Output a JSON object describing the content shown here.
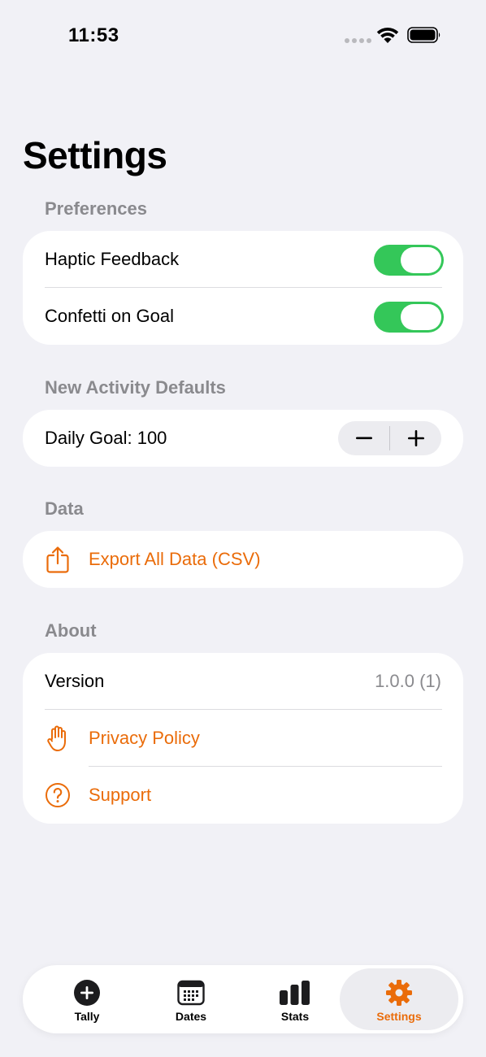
{
  "status_bar": {
    "time": "11:53"
  },
  "page_title": "Settings",
  "sections": {
    "preferences": {
      "header": "Preferences",
      "haptic_feedback": {
        "label": "Haptic Feedback",
        "on": true
      },
      "confetti_on_goal": {
        "label": "Confetti on Goal",
        "on": true
      }
    },
    "defaults": {
      "header": "New Activity Defaults",
      "daily_goal_label": "Daily Goal: 100",
      "decrement": "−",
      "increment": "+"
    },
    "data": {
      "header": "Data",
      "export_label": "Export All Data (CSV)",
      "export_icon": "share-icon"
    },
    "about": {
      "header": "About",
      "version_label": "Version",
      "version_value": "1.0.0 (1)",
      "privacy_label": "Privacy Policy",
      "privacy_icon": "hand-raised-icon",
      "support_label": "Support",
      "support_icon": "question-circle-icon"
    }
  },
  "tab_bar": {
    "tabs": [
      {
        "label": "Tally",
        "icon": "plus-circle-icon",
        "active": false
      },
      {
        "label": "Dates",
        "icon": "calendar-icon",
        "active": false
      },
      {
        "label": "Stats",
        "icon": "bar-chart-icon",
        "active": false
      },
      {
        "label": "Settings",
        "icon": "gear-icon",
        "active": true
      }
    ]
  },
  "colors": {
    "accent": "#ea6c0a",
    "toggle_on": "#34c759",
    "background": "#f1f1f6",
    "secondary_text": "#8a8a8e"
  }
}
